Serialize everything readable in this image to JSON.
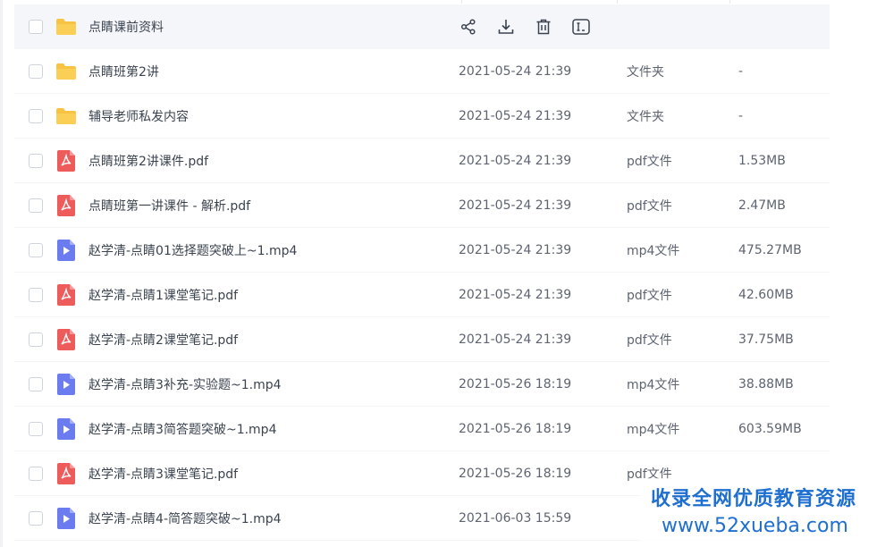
{
  "files": [
    {
      "name": "点睛课前资料",
      "date": "",
      "type": "",
      "size": "",
      "icon": "folder",
      "hover": true
    },
    {
      "name": "点睛班第2讲",
      "date": "2021-05-24 21:39",
      "type": "文件夹",
      "size": "-",
      "icon": "folder"
    },
    {
      "name": "辅导老师私发内容",
      "date": "2021-05-24 21:39",
      "type": "文件夹",
      "size": "-",
      "icon": "folder"
    },
    {
      "name": "点睛班第2讲课件.pdf",
      "date": "2021-05-24 21:39",
      "type": "pdf文件",
      "size": "1.53MB",
      "icon": "pdf"
    },
    {
      "name": "点睛班第一讲课件 - 解析.pdf",
      "date": "2021-05-24 21:39",
      "type": "pdf文件",
      "size": "2.47MB",
      "icon": "pdf"
    },
    {
      "name": "赵学清-点睛01选择题突破上~1.mp4",
      "date": "2021-05-24 21:39",
      "type": "mp4文件",
      "size": "475.27MB",
      "icon": "video"
    },
    {
      "name": "赵学清-点睛1课堂笔记.pdf",
      "date": "2021-05-24 21:39",
      "type": "pdf文件",
      "size": "42.60MB",
      "icon": "pdf"
    },
    {
      "name": "赵学清-点睛2课堂笔记.pdf",
      "date": "2021-05-24 21:39",
      "type": "pdf文件",
      "size": "37.75MB",
      "icon": "pdf"
    },
    {
      "name": "赵学清-点睛3补充-实验题~1.mp4",
      "date": "2021-05-26 18:19",
      "type": "mp4文件",
      "size": "38.88MB",
      "icon": "video"
    },
    {
      "name": "赵学清-点睛3简答题突破~1.mp4",
      "date": "2021-05-26 18:19",
      "type": "mp4文件",
      "size": "603.59MB",
      "icon": "video"
    },
    {
      "name": "赵学清-点睛3课堂笔记.pdf",
      "date": "2021-05-26 18:19",
      "type": "pdf文件",
      "size": "",
      "icon": "pdf"
    },
    {
      "name": "赵学清-点睛4-简答题突破~1.mp4",
      "date": "2021-06-03 15:59",
      "type": "",
      "size": "",
      "icon": "video"
    }
  ],
  "actions": [
    {
      "name": "share-icon"
    },
    {
      "name": "download-icon"
    },
    {
      "name": "trash-icon"
    },
    {
      "name": "rename-icon"
    }
  ],
  "watermark": {
    "line1": "收录全网优质教育资源",
    "line2": "www.52xueba.com"
  },
  "colors": {
    "folder": "#f8c342",
    "pdf": "#ee5b5b",
    "video": "#6b7cf0",
    "accent": "#1e6fd0"
  }
}
